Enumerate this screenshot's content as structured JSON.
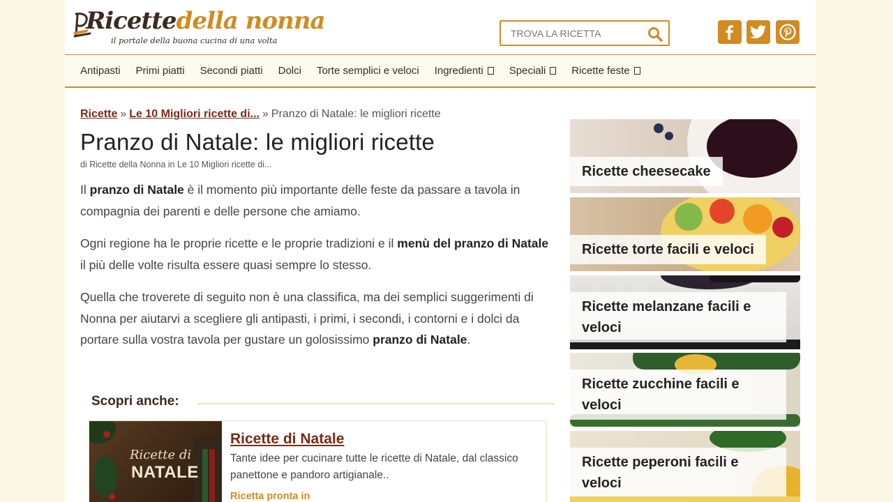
{
  "logo": {
    "title_part1": "Ricette",
    "title_part2": "della nonna",
    "tagline": "il portale della buona cucina di una volta"
  },
  "search": {
    "placeholder": "TROVA LA RICETTA"
  },
  "social": [
    "facebook-icon",
    "twitter-icon",
    "pinterest-icon"
  ],
  "nav": {
    "items": [
      {
        "label": "Antipasti",
        "dropdown": false
      },
      {
        "label": "Primi piatti",
        "dropdown": false
      },
      {
        "label": "Secondi piatti",
        "dropdown": false
      },
      {
        "label": "Dolci",
        "dropdown": false
      },
      {
        "label": "Torte semplici e veloci",
        "dropdown": false
      },
      {
        "label": "Ingredienti",
        "dropdown": true
      },
      {
        "label": "Speciali",
        "dropdown": true
      },
      {
        "label": "Ricette feste",
        "dropdown": true
      }
    ]
  },
  "breadcrumb": {
    "item1": "Ricette",
    "sep": "»",
    "item2": "Le 10 Migliori ricette di...",
    "current": "Pranzo di Natale: le migliori ricette"
  },
  "article": {
    "title": "Pranzo di Natale: le migliori ricette",
    "byline": "di Ricette della Nonna in Le 10 Migliori ricette di...",
    "p1_a": "Il ",
    "p1_b": "pranzo di Natale",
    "p1_c": " è il momento più importante delle feste da passare a tavola in compagnia dei parenti e delle persone che amiamo.",
    "p2_a": "Ogni regione ha le proprie ricette e le proprie tradizioni e il ",
    "p2_b": "menù del pranzo di Natale",
    "p2_c": " il più delle volte risulta essere quasi sempre lo stesso.",
    "p3_a": "Quella che troverete di seguito non è una classifica, ma dei semplici suggerimenti di Nonna per aiutarvi a scegliere gli antipasti, i primi, i secondi, i contorni e i dolci da portare sulla vostra tavola per gustare un golosissimo ",
    "p3_b": "pranzo di Natale",
    "p3_c": "."
  },
  "scopri": {
    "label": "Scopri anche:"
  },
  "related_card": {
    "thumb_line1": "Ricette di",
    "thumb_line2": "NATALE",
    "title": "Ricette di Natale",
    "description": "Tante idee per cucinare tutte le ricette di Natale, dal classico panettone e pandoro artigianale..",
    "more": "Ricetta pronta in"
  },
  "sidebar": {
    "tiles": [
      {
        "label": "Ricette cheesecake"
      },
      {
        "label": "Ricette torte facili e veloci"
      },
      {
        "label": "Ricette melanzane facili e veloci"
      },
      {
        "label": "Ricette zucchine facili e veloci"
      },
      {
        "label": "Ricette peperoni facili e veloci"
      }
    ]
  },
  "colors": {
    "accent": "#d18b21",
    "link": "#7a2a14",
    "page_bg": "#fdf8e6"
  }
}
